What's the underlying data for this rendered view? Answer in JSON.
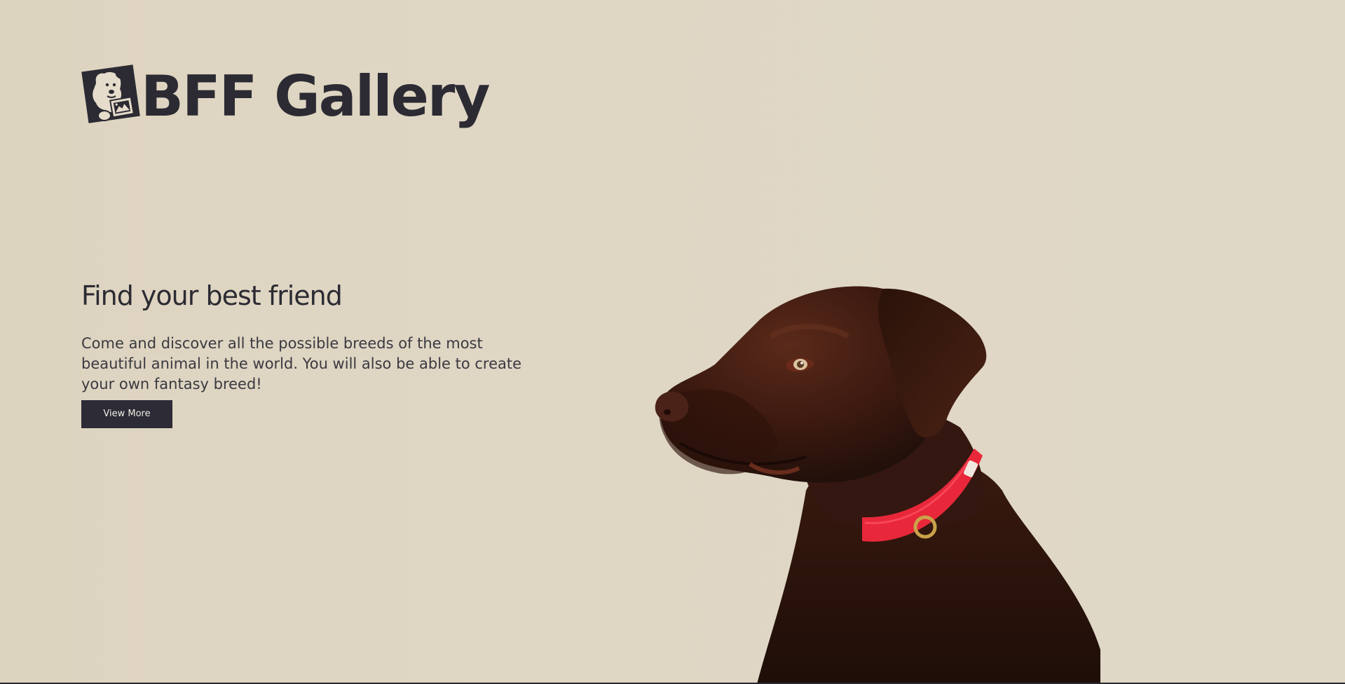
{
  "header": {
    "logo_text": "BFF Gallery",
    "logo_icon": "dog-picture-icon"
  },
  "hero": {
    "title": "Find your best friend",
    "description": "Come and discover all the possible breeds of the most beautiful animal in the world. You will also be able to create your own fantasy breed!",
    "button_label": "View More"
  },
  "colors": {
    "background": "#ded5c2",
    "text": "#2c2b33",
    "button_bg": "#2c2b36",
    "button_text": "#f2ede4",
    "dog_fur": "#3a1a10",
    "collar": "#e8283a"
  },
  "image": {
    "subject": "chocolate-labrador-photo"
  }
}
